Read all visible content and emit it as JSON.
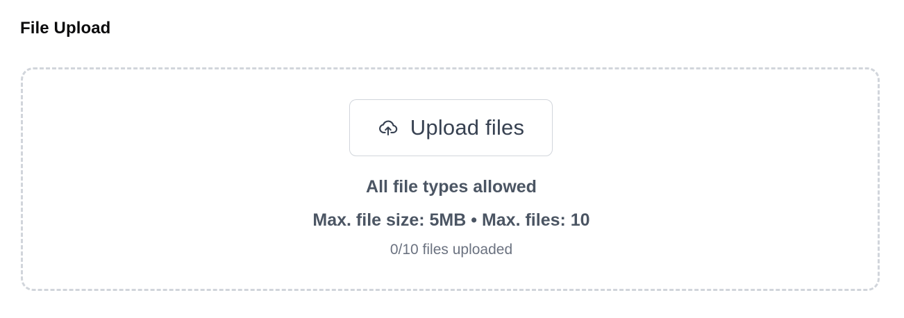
{
  "header": {
    "title": "File Upload"
  },
  "dropzone": {
    "button": {
      "label": "Upload files",
      "icon": "cloud-upload-icon"
    },
    "allowed_types": "All file types allowed",
    "limits": "Max. file size: 5MB • Max. files: 10",
    "status": "0/10 files uploaded"
  },
  "colors": {
    "border": "#d1d5db",
    "text_primary": "#0b0b0c",
    "text_secondary": "#4b5563",
    "text_muted": "#6b7280"
  }
}
